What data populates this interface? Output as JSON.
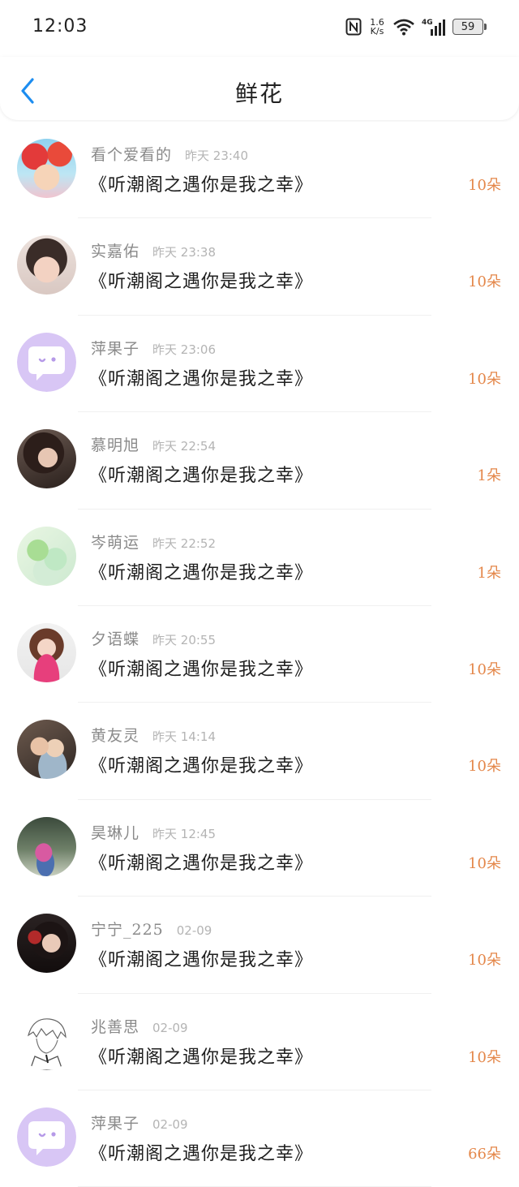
{
  "status_bar": {
    "time": "12:03",
    "net_speed_top": "1.6",
    "net_speed_unit": "K/s",
    "network": "4G",
    "battery": "59"
  },
  "header": {
    "title": "鲜花"
  },
  "icons": {
    "back": "chevron-left-icon",
    "nfc": "nfc-icon",
    "wifi": "wifi-icon",
    "signal": "signal-icon"
  },
  "colors": {
    "accent": "#1d8df0",
    "count": "#e4874a"
  },
  "items": [
    {
      "name": "看个爱看的",
      "time": "昨天 23:40",
      "book": "《听潮阁之遇你是我之幸》",
      "count": "10朵",
      "avatar": "photo"
    },
    {
      "name": "实嘉佑",
      "time": "昨天 23:38",
      "book": "《听潮阁之遇你是我之幸》",
      "count": "10朵",
      "avatar": "photo"
    },
    {
      "name": "萍果子",
      "time": "昨天 23:06",
      "book": "《听潮阁之遇你是我之幸》",
      "count": "10朵",
      "avatar": "default"
    },
    {
      "name": "慕明旭",
      "time": "昨天 22:54",
      "book": "《听潮阁之遇你是我之幸》",
      "count": "1朵",
      "avatar": "photo"
    },
    {
      "name": "岑萌运",
      "time": "昨天 22:52",
      "book": "《听潮阁之遇你是我之幸》",
      "count": "1朵",
      "avatar": "photo"
    },
    {
      "name": "夕语蝶",
      "time": "昨天 20:55",
      "book": "《听潮阁之遇你是我之幸》",
      "count": "10朵",
      "avatar": "photo"
    },
    {
      "name": "黄友灵",
      "time": "昨天 14:14",
      "book": "《听潮阁之遇你是我之幸》",
      "count": "10朵",
      "avatar": "photo"
    },
    {
      "name": "昊琳儿",
      "time": "昨天 12:45",
      "book": "《听潮阁之遇你是我之幸》",
      "count": "10朵",
      "avatar": "photo"
    },
    {
      "name": "宁宁_225",
      "time": "02-09",
      "book": "《听潮阁之遇你是我之幸》",
      "count": "10朵",
      "avatar": "photo"
    },
    {
      "name": "兆善思",
      "time": "02-09",
      "book": "《听潮阁之遇你是我之幸》",
      "count": "10朵",
      "avatar": "photo"
    },
    {
      "name": "萍果子",
      "time": "02-09",
      "book": "《听潮阁之遇你是我之幸》",
      "count": "66朵",
      "avatar": "default"
    }
  ]
}
